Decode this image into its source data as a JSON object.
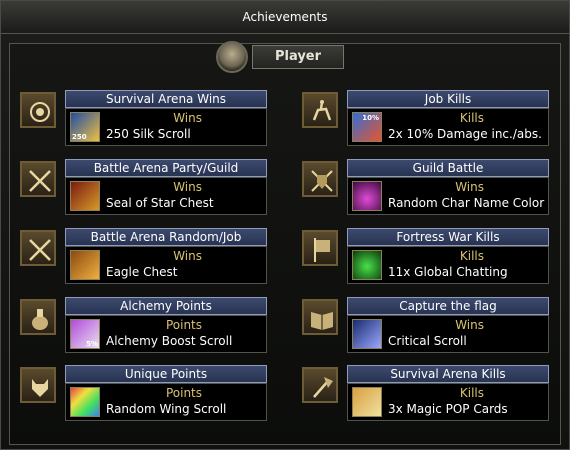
{
  "window": {
    "title": "Achievements"
  },
  "tab": {
    "label": "Player"
  },
  "achievements": [
    {
      "title": "Survival Arena Wins",
      "type": "Wins",
      "reward": "250 Silk Scroll",
      "badge_icon": "medal-icon",
      "reward_icon": "silk-scroll-icon",
      "reward_tag": "250"
    },
    {
      "title": "Job Kills",
      "type": "Kills",
      "reward": "2x 10% Damage inc./abs.",
      "badge_icon": "horse-rider-icon",
      "reward_icon": "damage-scroll-icon",
      "reward_tag": "10%"
    },
    {
      "title": "Battle Arena Party/Guild",
      "type": "Wins",
      "reward": "Seal of Star Chest",
      "badge_icon": "crossed-swords-icon",
      "reward_icon": "star-chest-icon",
      "reward_tag": ""
    },
    {
      "title": "Guild Battle",
      "type": "Wins",
      "reward": "Random Char Name Color",
      "badge_icon": "shield-swords-icon",
      "reward_icon": "potion-icon",
      "reward_tag": ""
    },
    {
      "title": "Battle Arena Random/Job",
      "type": "Wins",
      "reward": "Eagle Chest",
      "badge_icon": "crossed-swords-icon",
      "reward_icon": "eagle-chest-icon",
      "reward_tag": ""
    },
    {
      "title": "Fortress War Kills",
      "type": "Kills",
      "reward": "11x Global Chatting",
      "badge_icon": "banner-icon",
      "reward_icon": "global-chat-icon",
      "reward_tag": ""
    },
    {
      "title": "Alchemy Points",
      "type": "Points",
      "reward": "Alchemy Boost Scroll",
      "badge_icon": "alchemy-pot-icon",
      "reward_icon": "alchemy-scroll-icon",
      "reward_tag": "5%"
    },
    {
      "title": "Capture the flag",
      "type": "Wins",
      "reward": "Critical Scroll",
      "badge_icon": "book-icon",
      "reward_icon": "critical-scroll-icon",
      "reward_tag": ""
    },
    {
      "title": "Unique Points",
      "type": "Points",
      "reward": "Random Wing Scroll",
      "badge_icon": "wolf-icon",
      "reward_icon": "wing-scroll-icon",
      "reward_tag": ""
    },
    {
      "title": "Survival Arena Kills",
      "type": "Kills",
      "reward": "3x Magic POP Cards",
      "badge_icon": "axe-icon",
      "reward_icon": "pop-card-icon",
      "reward_tag": ""
    }
  ]
}
